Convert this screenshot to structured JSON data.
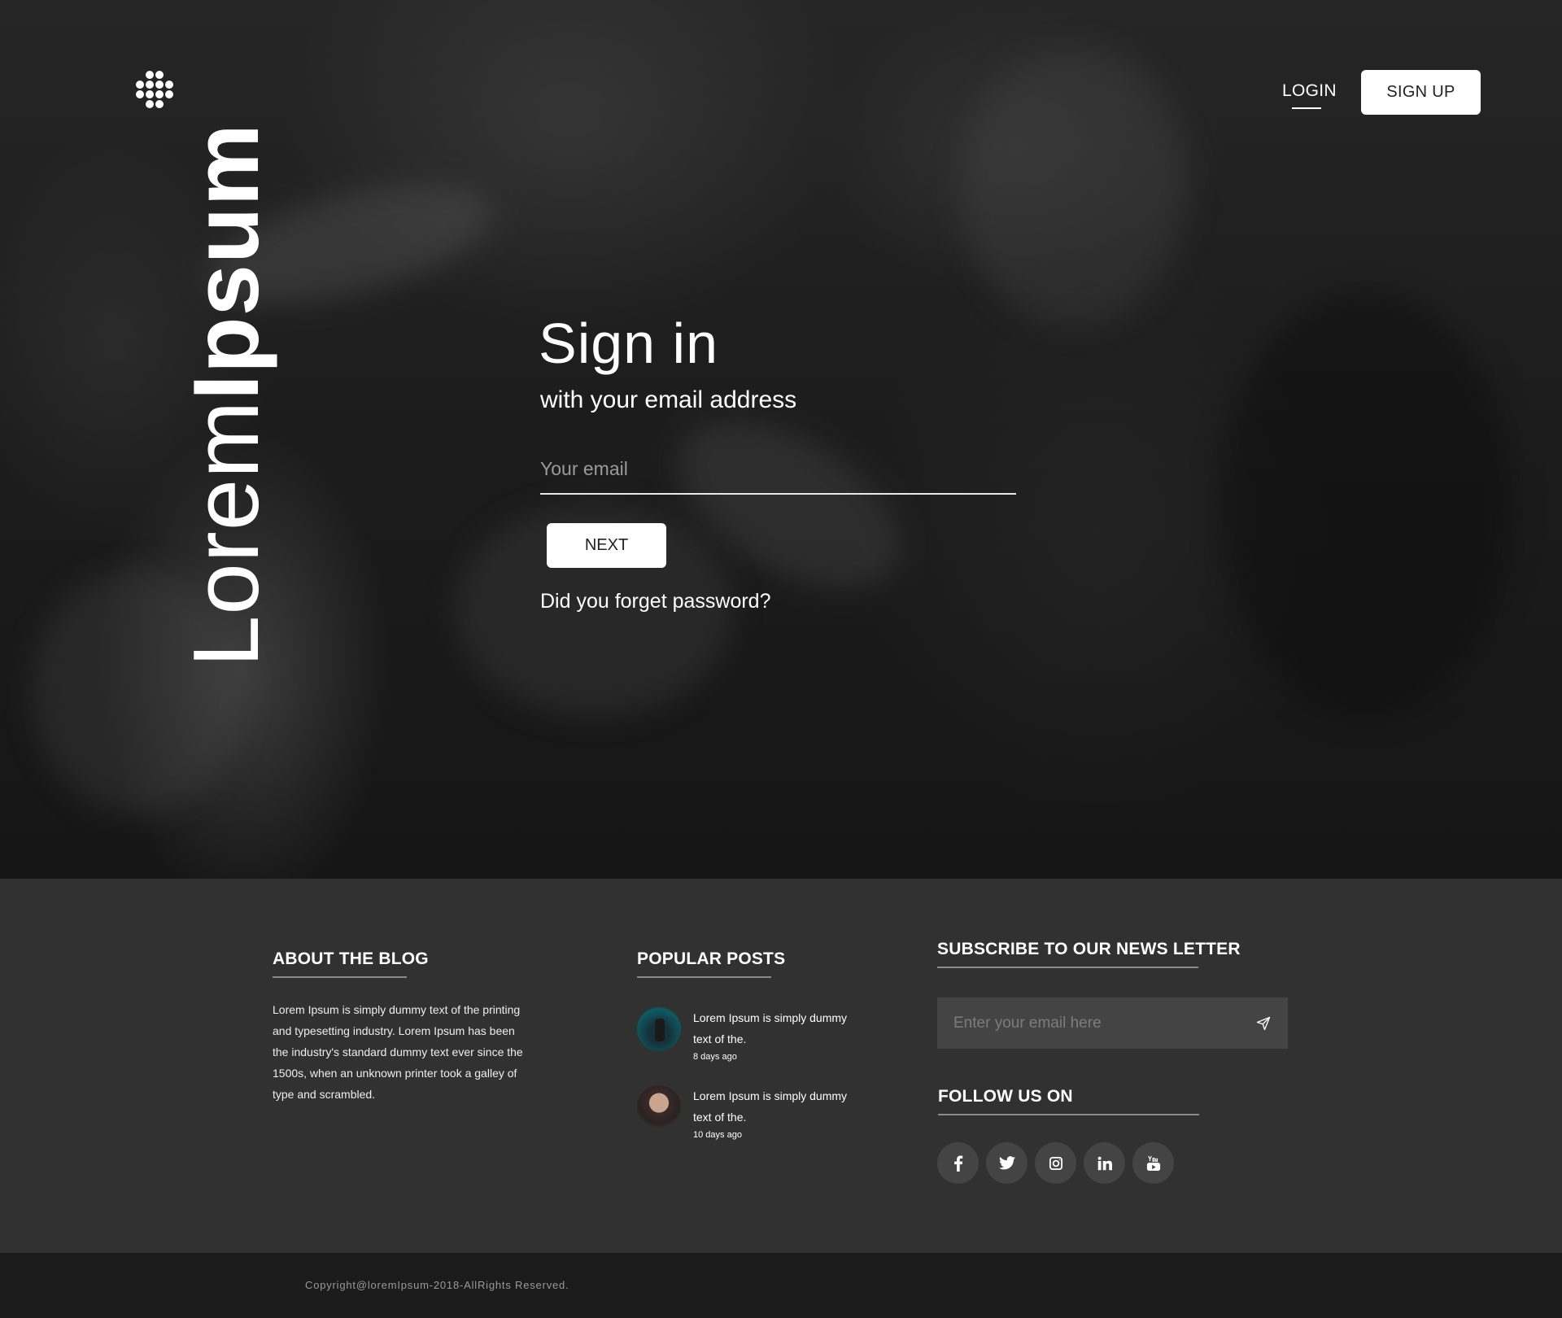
{
  "nav": {
    "login_label": "LOGIN",
    "signup_label": "SIGN UP"
  },
  "brand": {
    "light": "Lorem",
    "bold": "Ipsum",
    "menu_icon": "grid-dots-icon"
  },
  "signin": {
    "title": "Sign in",
    "subtitle": "with your email address",
    "email_placeholder": "Your email",
    "email_value": "",
    "next_label": "NEXT",
    "forgot_label": "Did you forget password?"
  },
  "footer": {
    "about": {
      "heading": "ABOUT THE BLOG",
      "text": "Lorem Ipsum is simply dummy text of the printing and typesetting industry. Lorem Ipsum has been the industry's standard dummy text ever since the 1500s, when an unknown printer took a galley of type and scrambled."
    },
    "popular": {
      "heading": "POPULAR POSTS",
      "posts": [
        {
          "title": "Lorem Ipsum is simply dummy text of the.",
          "ago": "8 days ago"
        },
        {
          "title": "Lorem Ipsum is simply dummy text of the.",
          "ago": "10 days ago"
        }
      ]
    },
    "subscribe": {
      "heading": "SUBSCRIBE TO OUR NEWS LETTER",
      "placeholder": "Enter your email here",
      "send_icon": "paper-plane-icon"
    },
    "follow": {
      "heading": "FOLLOW US ON",
      "icons": [
        "facebook-icon",
        "twitter-icon",
        "instagram-icon",
        "linkedin-icon",
        "youtube-icon"
      ]
    },
    "copyright": "Copyright@loremIpsum-2018-AllRights Reserved."
  }
}
